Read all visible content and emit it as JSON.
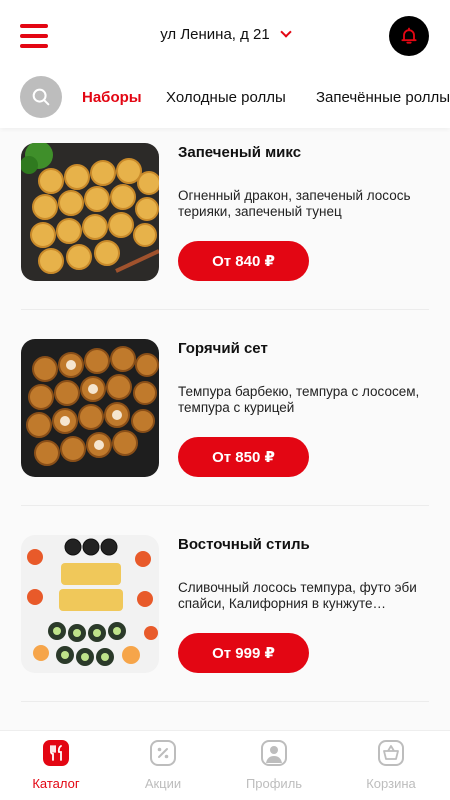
{
  "header": {
    "address": "ул Ленина, д 21"
  },
  "categories": [
    "Наборы",
    "Холодные роллы",
    "Запечённые роллы"
  ],
  "products": [
    {
      "title": "Запеченый микс",
      "description": "Огненный дракон, запеченый лосось терияки, запеченый тунец",
      "price": "От 840 ₽"
    },
    {
      "title": "Горячий сет",
      "description": "Темпура барбекю, темпура с лососем, темпура с курицей",
      "price": "От 850 ₽"
    },
    {
      "title": "Восточный стиль",
      "description": "Сливочный лосось темпура, футо эби спайси, Калифорния в кунжуте…",
      "price": "От 999 ₽"
    }
  ],
  "tabbar": {
    "catalog": "Каталог",
    "promo": "Акции",
    "profile": "Профиль",
    "cart": "Корзина"
  },
  "colors": {
    "accent": "#e30613",
    "inactive": "#bdbdbd"
  },
  "icons": [
    "menu-icon",
    "chevron-down-icon",
    "bell-icon",
    "search-icon",
    "catalog-icon",
    "promo-icon",
    "profile-icon",
    "cart-icon"
  ]
}
